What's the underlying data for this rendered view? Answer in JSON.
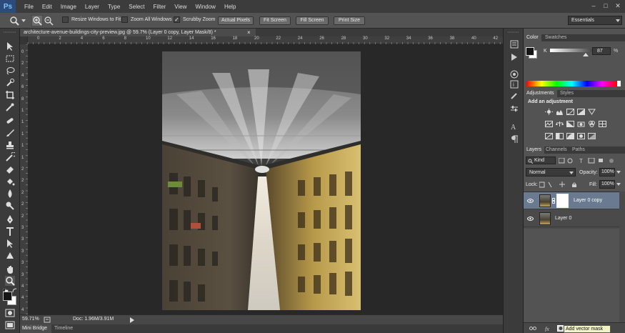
{
  "app": {
    "logo": "Ps"
  },
  "menu": [
    "File",
    "Edit",
    "Image",
    "Layer",
    "Type",
    "Select",
    "Filter",
    "View",
    "Window",
    "Help"
  ],
  "window_controls": {
    "minimize": "–",
    "restore": "□",
    "close": "✕"
  },
  "options_bar": {
    "resize_windows": "Resize Windows to Fit",
    "zoom_all": "Zoom All Windows",
    "scrubby_zoom": "Scrubby Zoom",
    "scrubby_checked": "✓",
    "actual_pixels": "Actual Pixels",
    "fit_screen": "Fit Screen",
    "fill_screen": "Fill Screen",
    "print_size": "Print Size",
    "workspace": "Essentials"
  },
  "document_tab": {
    "title": "architecture-avenue-buildings-city-preview.jpg @ 59.7% (Layer 0 copy, Layer Mask/8) *",
    "close": "×"
  },
  "ruler_top": [
    "0",
    "2",
    "4",
    "6",
    "8",
    "10",
    "12",
    "14",
    "16",
    "18",
    "20",
    "22",
    "24",
    "26",
    "28",
    "30",
    "32",
    "34",
    "36",
    "38",
    "40",
    "42"
  ],
  "ruler_left": [
    "0",
    "2",
    "4",
    "6",
    "8",
    "1",
    "1",
    "1",
    "1",
    "1",
    "2",
    "2",
    "2",
    "2",
    "2",
    "3",
    "3",
    "3",
    "3",
    "3",
    "4",
    "4",
    "4"
  ],
  "status": {
    "zoom": "59.71%",
    "doc": "Doc: 1.96M/3.91M"
  },
  "bottom_tabs": {
    "mini_bridge": "Mini Bridge",
    "timeline": "Timeline"
  },
  "color_panel": {
    "tabs": [
      "Color",
      "Swatches"
    ],
    "channel_label": "K",
    "channel_value": "87",
    "channel_percent": "%",
    "fg_color": "#151515",
    "bg_color": "#ffffff"
  },
  "adjustments_panel": {
    "tabs": [
      "Adjustments",
      "Styles"
    ],
    "heading": "Add an adjustment"
  },
  "layers_panel": {
    "tabs": [
      "Layers",
      "Channels",
      "Paths"
    ],
    "kind": "Kind",
    "blend_mode": "Normal",
    "opacity_label": "Opacity:",
    "opacity": "100%",
    "lock_label": "Lock:",
    "fill_label": "Fill:",
    "fill": "100%",
    "layers": [
      {
        "name": "Layer 0 copy",
        "selected": true
      },
      {
        "name": "Layer 0",
        "selected": false
      }
    ]
  },
  "tooltip": "Add vector mask"
}
